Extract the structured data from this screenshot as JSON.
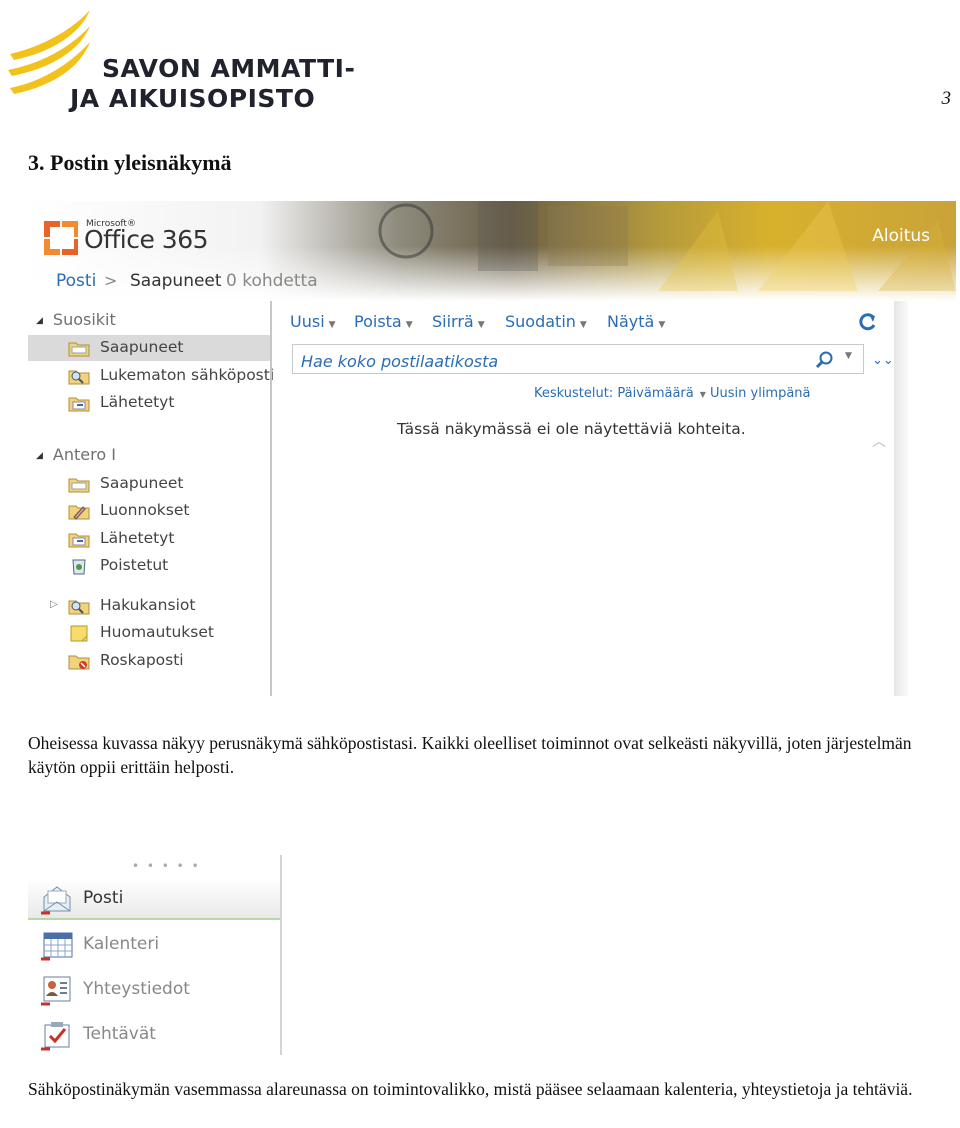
{
  "header": {
    "org_name_line1": "SAVON AMMATTI-",
    "org_name_line2": "JA AIKUISOPISTO",
    "page_number": "3",
    "brand_color": "#f2c21b"
  },
  "heading": "3. Postin yleisnäkymä",
  "owa": {
    "ms_label": "Microsoft®",
    "product": "Office 365",
    "home_link": "Aloitus",
    "breadcrumb": {
      "root": "Posti",
      "separator": ">",
      "folder": "Saapuneet",
      "count": "0 kohdetta"
    },
    "favorites": {
      "title": "Suosikit",
      "items": [
        {
          "label": "Saapuneet",
          "icon": "inbox-folder-icon",
          "selected": true
        },
        {
          "label": "Lukematon sähköposti",
          "icon": "search-folder-icon"
        },
        {
          "label": "Lähetetyt",
          "icon": "sent-folder-icon"
        }
      ]
    },
    "mailbox": {
      "title": "Antero I",
      "items": [
        {
          "label": "Saapuneet",
          "icon": "inbox-folder-icon"
        },
        {
          "label": "Luonnokset",
          "icon": "drafts-folder-icon"
        },
        {
          "label": "Lähetetyt",
          "icon": "sent-folder-icon"
        },
        {
          "label": "Poistetut",
          "icon": "deleted-items-icon"
        },
        {
          "label": "Hakukansiot",
          "icon": "search-folder-icon",
          "expandable": true
        },
        {
          "label": "Huomautukset",
          "icon": "notes-folder-icon"
        },
        {
          "label": "Roskaposti",
          "icon": "junk-folder-icon"
        }
      ]
    },
    "toolbar": {
      "new": "Uusi",
      "delete": "Poista",
      "move": "Siirrä",
      "filter": "Suodatin",
      "view": "Näytä"
    },
    "search": {
      "placeholder": "Hae koko postilaatikosta"
    },
    "sort": {
      "conversations": "Keskustelut: Päivämäärä",
      "order": "Uusin ylimpänä"
    },
    "empty_message": "Tässä näkymässä ei ole näytettäviä kohteita.",
    "link_color": "#2a6db4"
  },
  "paragraph1": "Oheisessa kuvassa näkyy perusnäkymä sähköpostistasi. Kaikki oleelliset toiminnot ovat selkeästi näkyvillä, joten järjestelmän käytön oppii erittäin helposti.",
  "navigation": {
    "grip": "• • • • •",
    "items": [
      {
        "label": "Posti",
        "icon": "mail-icon",
        "active": true
      },
      {
        "label": "Kalenteri",
        "icon": "calendar-icon"
      },
      {
        "label": "Yhteystiedot",
        "icon": "contacts-icon"
      },
      {
        "label": "Tehtävät",
        "icon": "tasks-icon"
      }
    ]
  },
  "paragraph2": "Sähköpostinäkymän vasemmassa alareunassa on toimintovalikko, mistä pääsee selaamaan kalenteria, yhteystietoja ja tehtäviä."
}
